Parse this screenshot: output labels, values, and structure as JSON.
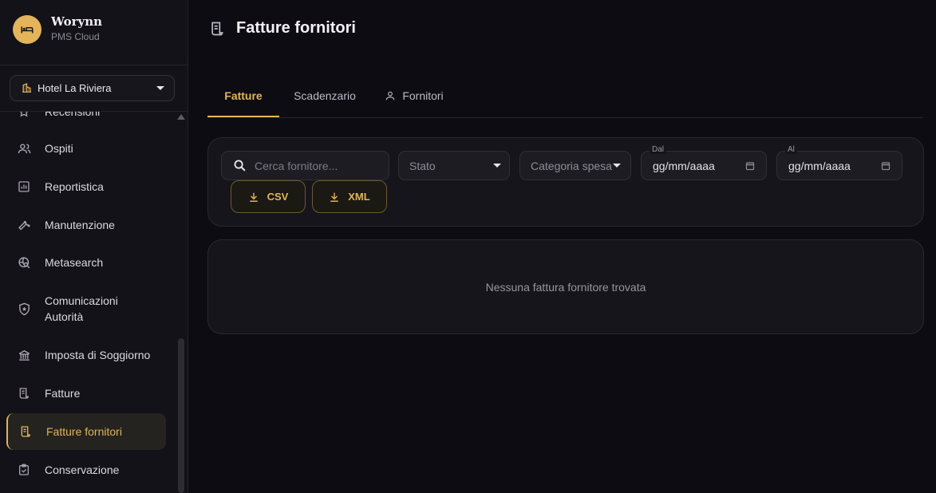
{
  "brand": {
    "name": "Worynn",
    "subtitle": "PMS Cloud",
    "accent": "#e2b45b"
  },
  "hotel_selector": {
    "value": "Hotel La Riviera"
  },
  "sidebar": {
    "items": [
      {
        "label": "Recensioni",
        "icon": "star-icon"
      },
      {
        "label": "Ospiti",
        "icon": "people-icon"
      },
      {
        "label": "Reportistica",
        "icon": "chart-icon"
      },
      {
        "label": "Manutenzione",
        "icon": "wrench-icon"
      },
      {
        "label": "Metasearch",
        "icon": "globe-search-icon"
      },
      {
        "label": "Comunicazioni",
        "label2": "Autorità",
        "icon": "shield-icon"
      },
      {
        "label": "Imposta di Soggiorno",
        "icon": "bank-icon"
      },
      {
        "label": "Fatture",
        "icon": "receipt-icon"
      },
      {
        "label": "Fatture fornitori",
        "icon": "receipt-icon",
        "active": true
      },
      {
        "label": "Conservazione",
        "icon": "clipboard-check-icon"
      }
    ]
  },
  "page": {
    "title": "Fatture fornitori",
    "icon": "receipt-icon"
  },
  "tabs": [
    {
      "label": "Fatture",
      "active": true
    },
    {
      "label": "Scadenzario"
    },
    {
      "label": "Fornitori",
      "icon": "person-icon"
    }
  ],
  "filters": {
    "search_placeholder": "Cerca fornitore...",
    "status": "Stato",
    "category": "Categoria spesa",
    "from_label": "Dal",
    "from_value": "gg/mm/aaaa",
    "to_label": "Al",
    "to_value": "gg/mm/aaaa"
  },
  "exports": {
    "csv": "CSV",
    "xml": "XML"
  },
  "empty_state": {
    "message": "Nessuna fattura fornitore trovata"
  }
}
